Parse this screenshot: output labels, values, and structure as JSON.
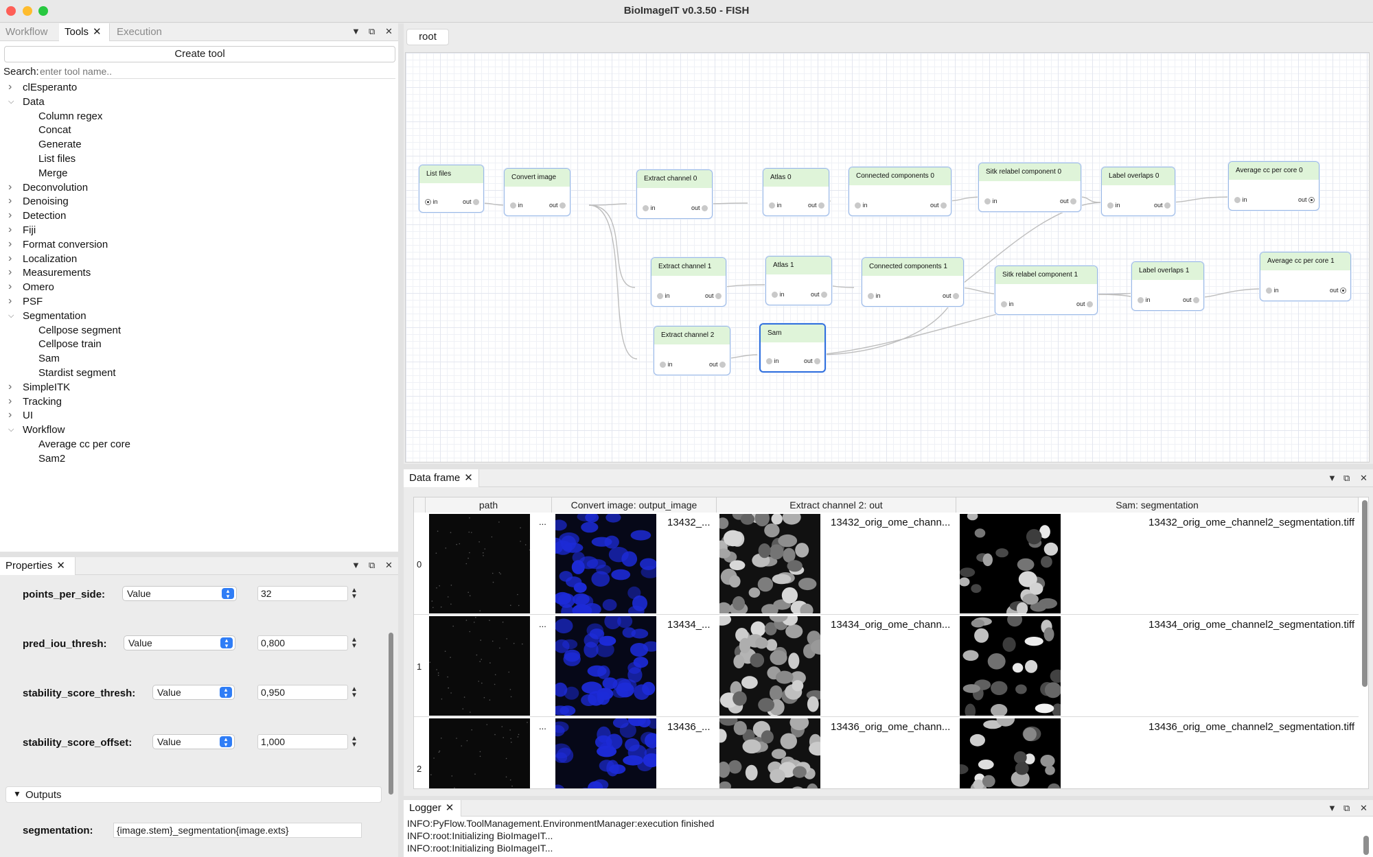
{
  "window": {
    "title": "BioImageIT v0.3.50 - FISH"
  },
  "left_tabs": [
    {
      "label": "Workflow"
    },
    {
      "label": "Tools"
    },
    {
      "label": "Execution"
    }
  ],
  "tools": {
    "create_label": "Create tool",
    "search_label": "Search:",
    "search_placeholder": "enter tool name..",
    "tree": [
      {
        "label": "clEsperanto",
        "expanded": false
      },
      {
        "label": "Data",
        "expanded": true
      },
      {
        "label": "Column regex",
        "child": true
      },
      {
        "label": "Concat",
        "child": true
      },
      {
        "label": "Generate",
        "child": true
      },
      {
        "label": "List files",
        "child": true
      },
      {
        "label": "Merge",
        "child": true
      },
      {
        "label": "Deconvolution",
        "expanded": false
      },
      {
        "label": "Denoising",
        "expanded": false
      },
      {
        "label": "Detection",
        "expanded": false
      },
      {
        "label": "Fiji",
        "expanded": false
      },
      {
        "label": "Format conversion",
        "expanded": false
      },
      {
        "label": "Localization",
        "expanded": false
      },
      {
        "label": "Measurements",
        "expanded": false
      },
      {
        "label": "Omero",
        "expanded": false
      },
      {
        "label": "PSF",
        "expanded": false
      },
      {
        "label": "Segmentation",
        "expanded": true
      },
      {
        "label": "Cellpose segment",
        "child": true
      },
      {
        "label": "Cellpose train",
        "child": true
      },
      {
        "label": "Sam",
        "child": true
      },
      {
        "label": "Stardist segment",
        "child": true
      },
      {
        "label": "SimpleITK",
        "expanded": false
      },
      {
        "label": "Tracking",
        "expanded": false
      },
      {
        "label": "UI",
        "expanded": false
      },
      {
        "label": "Workflow",
        "expanded": true
      },
      {
        "label": "Average cc per core",
        "child": true
      },
      {
        "label": "Sam2",
        "child": true
      }
    ]
  },
  "properties": {
    "tab_label": "Properties",
    "params": [
      {
        "label": "points_per_side:",
        "mode": "Value",
        "value": "32"
      },
      {
        "label": "pred_iou_thresh:",
        "mode": "Value",
        "value": "0,800"
      },
      {
        "label": "stability_score_thresh:",
        "mode": "Value",
        "value": "0,950"
      },
      {
        "label": "stability_score_offset:",
        "mode": "Value",
        "value": "1,000"
      }
    ],
    "outputs_label": "Outputs",
    "segmentation_label": "segmentation:",
    "segmentation_value": "{image.stem}_segmentation{image.exts}"
  },
  "graph": {
    "breadcrumb": "root",
    "port_in": "in",
    "port_out": "out",
    "nodes": [
      {
        "label": "List files"
      },
      {
        "label": "Convert image"
      },
      {
        "label": "Extract channel 0"
      },
      {
        "label": "Atlas 0"
      },
      {
        "label": "Connected components 0"
      },
      {
        "label": "Sitk relabel component 0"
      },
      {
        "label": "Label overlaps 0"
      },
      {
        "label": "Average cc per core 0"
      },
      {
        "label": "Extract channel 1"
      },
      {
        "label": "Atlas 1"
      },
      {
        "label": "Connected components 1"
      },
      {
        "label": "Sitk relabel component 1"
      },
      {
        "label": "Label overlaps 1"
      },
      {
        "label": "Average cc per core 1"
      },
      {
        "label": "Extract channel 2"
      },
      {
        "label": "Sam"
      }
    ]
  },
  "dataframe": {
    "tab_label": "Data frame",
    "columns": [
      "path",
      "Convert image: output_image",
      "Extract channel 2: out",
      "Sam: segmentation"
    ],
    "ellipsis": "...",
    "rows": [
      {
        "index": "0",
        "convert": "13432_...",
        "extract": "13432_orig_ome_chann...",
        "sam": "13432_orig_ome_channel2_segmentation.tiff"
      },
      {
        "index": "1",
        "convert": "13434_...",
        "extract": "13434_orig_ome_chann...",
        "sam": "13434_orig_ome_channel2_segmentation.tiff"
      },
      {
        "index": "2",
        "convert": "13436_...",
        "extract": "13436_orig_ome_chann...",
        "sam": "13436_orig_ome_channel2_segmentation.tiff"
      }
    ]
  },
  "logger": {
    "tab_label": "Logger",
    "lines": [
      "INFO:PyFlow.ToolManagement.EnvironmentManager:execution finished",
      "INFO:root:Initializing BioImageIT...",
      "INFO:root:Initializing BioImageIT..."
    ]
  },
  "colors": {
    "accent": "#2f7df6",
    "node_header": "#dff4d9",
    "selected_border": "#2f6fde"
  }
}
